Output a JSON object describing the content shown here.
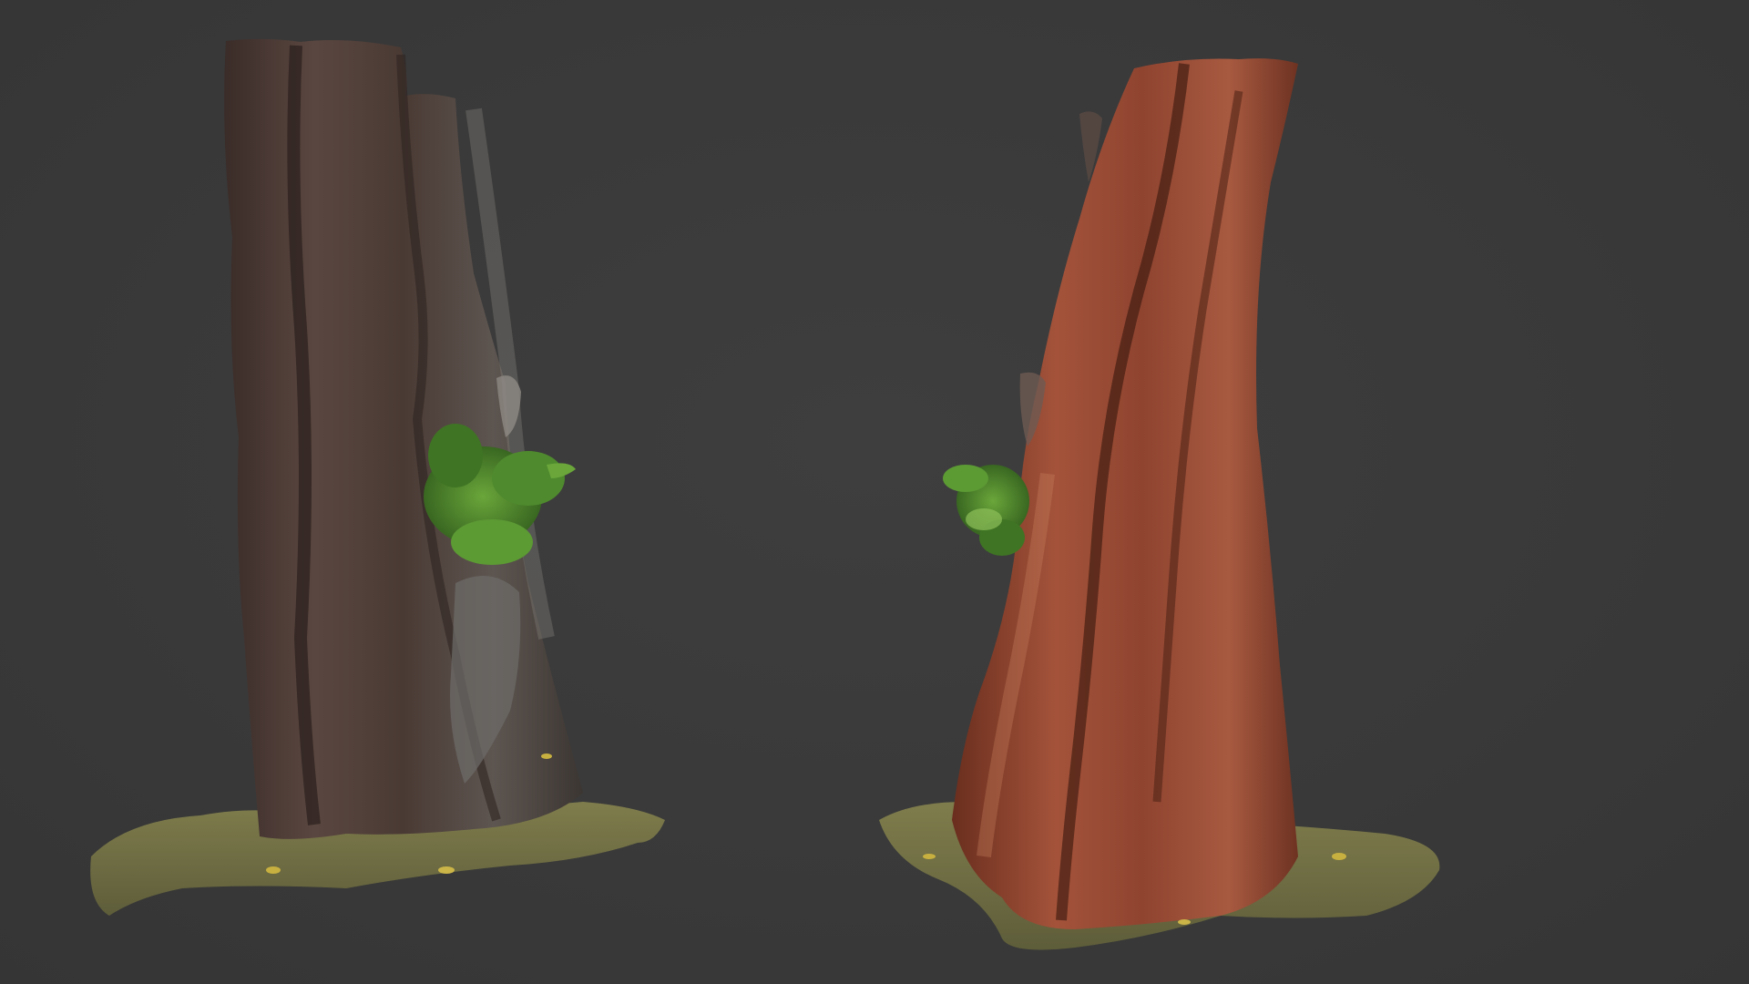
{
  "scene": {
    "background_color": "#3b3b3b",
    "objects": [
      {
        "id": "left-stump",
        "kind": "photoscanned-tree-stump",
        "material": "dark-bark",
        "bark_color": "#4a3a34",
        "has_foliage": true,
        "has_moss_base": true
      },
      {
        "id": "right-stump",
        "kind": "photoscanned-tree-stump",
        "material": "red-bark",
        "bark_color": "#9a4a30",
        "has_foliage": true,
        "has_moss_base": true
      }
    ]
  },
  "colors": {
    "moss": "#7d7a4a",
    "foliage": "#4f8a2e",
    "dark_bark": "#4a3a34",
    "red_bark": "#9a4a30"
  }
}
